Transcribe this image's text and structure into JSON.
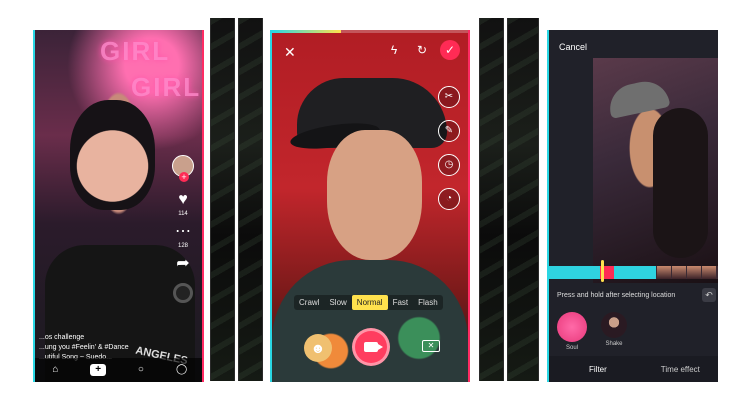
{
  "phone1": {
    "neon_top": "GIRL",
    "neon_bottom": "GIRL",
    "counts": [
      "114",
      "128"
    ],
    "caption_line1": "...os challenge",
    "caption_line2": "...ung you #Feelin' & #Dance",
    "caption_line3": "...utiful Song ~ Suedo...",
    "shirt_text": "ANGELES",
    "icons": {
      "heart": "heart-icon",
      "comment": "comment-icon",
      "share": "share-icon",
      "home": "home-icon",
      "add": "plus-icon",
      "search": "search-icon",
      "profile": "profile-icon"
    }
  },
  "phone2": {
    "progress_fraction": 0.35,
    "speed_options": [
      "Crawl",
      "Slow",
      "Normal",
      "Fast",
      "Flash"
    ],
    "selected_speed": "Normal",
    "icons": {
      "close": "close-icon",
      "flash_off": "flash-off-icon",
      "flip": "flip-camera-icon",
      "confirm": "check-icon",
      "scissors": "scissors-icon",
      "beauty": "beauty-icon",
      "timer": "timer-icon",
      "speed": "speed-icon",
      "record": "video-camera-icon",
      "delete": "backspace-icon"
    }
  },
  "phone3": {
    "cancel_label": "Cancel",
    "hint": "Press and hold after selecting location",
    "filters": [
      "Soul",
      "Shake"
    ],
    "tab_filter": "Filter",
    "tab_time": "Time effect",
    "timeline_colors": [
      "#2fd3e0",
      "#ff2b55",
      "#2fd3e0",
      "#ffe14d"
    ]
  },
  "colors": {
    "accent_pink": "#ff2b55",
    "accent_cyan": "#29d7e4",
    "accent_yellow": "#ffe14d"
  }
}
